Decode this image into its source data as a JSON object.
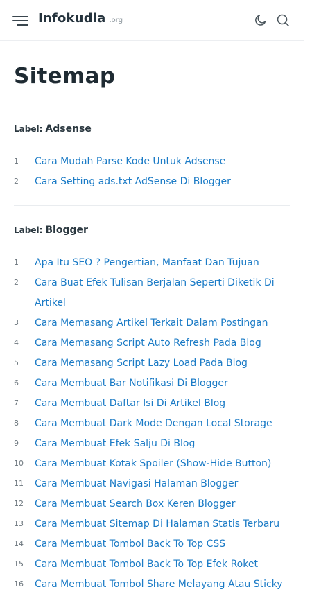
{
  "header": {
    "brand_name": "Infokudia",
    "brand_tld": ".org",
    "icons": {
      "menu": "menu-icon",
      "theme": "moon-icon",
      "search": "search-icon"
    }
  },
  "page": {
    "title": "Sitemap"
  },
  "colors": {
    "link": "#1b7bc6",
    "text": "#1f2b33",
    "muted": "#6d777e"
  },
  "sections": [
    {
      "label_prefix": "Label:",
      "label_name": "Adsense",
      "posts": [
        {
          "num": "1",
          "title": "Cara Mudah Parse Kode Untuk Adsense"
        },
        {
          "num": "2",
          "title": "Cara Setting ads.txt AdSense Di Blogger"
        }
      ]
    },
    {
      "label_prefix": "Label:",
      "label_name": "Blogger",
      "posts": [
        {
          "num": "1",
          "title": "Apa Itu SEO ? Pengertian, Manfaat Dan Tujuan"
        },
        {
          "num": "2",
          "title": "Cara Buat Efek Tulisan Berjalan Seperti Diketik Di Artikel"
        },
        {
          "num": "3",
          "title": "Cara Memasang Artikel Terkait Dalam Postingan"
        },
        {
          "num": "4",
          "title": "Cara Memasang Script Auto Refresh Pada Blog"
        },
        {
          "num": "5",
          "title": "Cara Memasang Script Lazy Load Pada Blog"
        },
        {
          "num": "6",
          "title": "Cara Membuat Bar Notifikasi Di Blogger"
        },
        {
          "num": "7",
          "title": "Cara Membuat Daftar Isi Di Artikel Blog"
        },
        {
          "num": "8",
          "title": "Cara Membuat Dark Mode Dengan Local Storage"
        },
        {
          "num": "9",
          "title": "Cara Membuat Efek Salju Di Blog"
        },
        {
          "num": "10",
          "title": "Cara Membuat Kotak Spoiler (Show-Hide Button)"
        },
        {
          "num": "11",
          "title": "Cara Membuat Navigasi Halaman Blogger"
        },
        {
          "num": "12",
          "title": "Cara Membuat Search Box Keren Blogger"
        },
        {
          "num": "13",
          "title": "Cara Membuat Sitemap Di Halaman Statis Terbaru"
        },
        {
          "num": "14",
          "title": "Cara Membuat Tombol Back To Top CSS"
        },
        {
          "num": "15",
          "title": "Cara Membuat Tombol Back To Top Efek Roket"
        },
        {
          "num": "16",
          "title": "Cara Membuat Tombol Share Melayang Atau Sticky"
        }
      ]
    }
  ]
}
